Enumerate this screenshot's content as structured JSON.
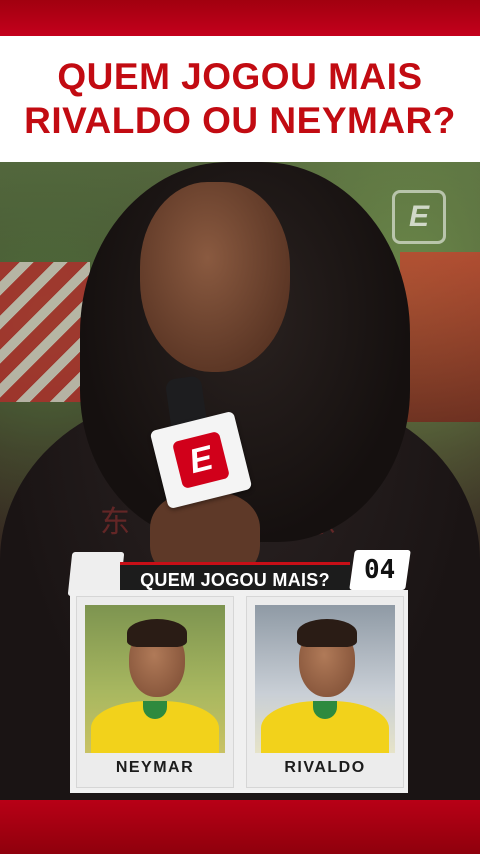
{
  "headline": {
    "line1": "QUEM JOGOU MAIS",
    "line2": "RIVALDO OU NEYMAR?",
    "color": "#c20b12"
  },
  "video": {
    "watermark_icon": "espn-e-logo-icon",
    "mic_flag_icon": "espn-e-logo-icon",
    "watermark_glyph": "E",
    "mic_glyph": "E"
  },
  "poll": {
    "title": "QUEM JOGOU MAIS?",
    "number": "04",
    "accent": "#c70f17",
    "options": [
      {
        "name": "NEYMAR"
      },
      {
        "name": "RIVALDO"
      }
    ]
  },
  "colors": {
    "top_bar": "#b5001a",
    "bottom_bar": "#a8000f"
  }
}
